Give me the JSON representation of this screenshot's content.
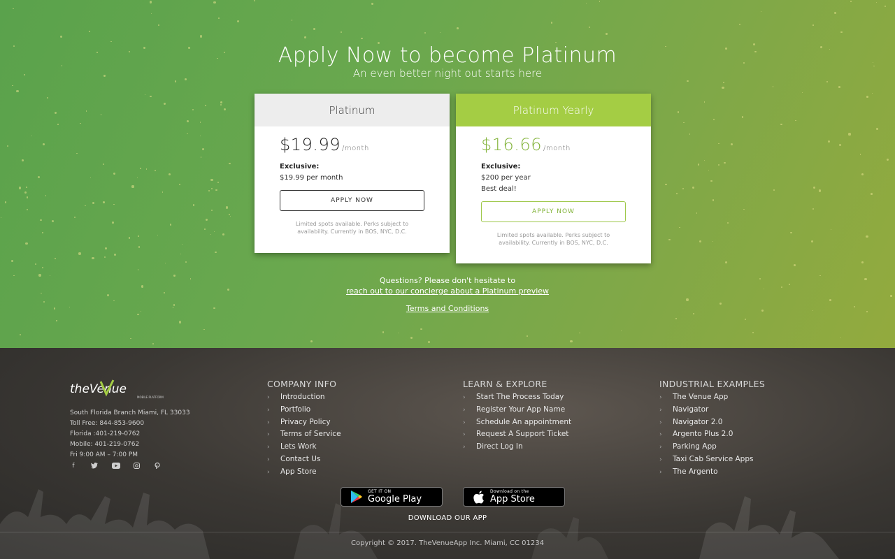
{
  "hero": {
    "title": "Apply Now to become Platinum",
    "subtitle": "An even better night out starts here"
  },
  "plans": [
    {
      "name": "Platinum",
      "price": "$19.99",
      "per": "/month",
      "perk_title": "Exclusive:",
      "perk_lines": [
        "$19.99 per month"
      ],
      "button": "APPLY NOW",
      "fine_print": "Limited spots available. Perks subject to availability. Currently in BOS, NYC, D.C."
    },
    {
      "name": "Platinum Yearly",
      "price": "$16.66",
      "per": "/month",
      "perk_title": "Exclusive:",
      "perk_lines": [
        "$200 per year",
        "Best deal!"
      ],
      "button": "APPLY NOW",
      "fine_print": "Limited spots available. Perks subject to availability. Currently in BOS, NYC, D.C."
    }
  ],
  "questions": {
    "prefix": "Questions? Please don't hesitate to ",
    "link": "reach out to our concierge about a Platinum preview"
  },
  "terms_link": "Terms and Conditions",
  "footer": {
    "logo_text": "theVenue",
    "logo_tagline": "MOBILE PLATFORM",
    "contact": [
      "South Florida Branch Miami, FL 33033",
      "Toll Free: 844-853-9600",
      "Florida :401-219-0762",
      "Mobile: 401-219-0762",
      "Fri 9:00 AM – 7:00 PM"
    ],
    "social_icons": [
      "facebook-icon",
      "twitter-icon",
      "youtube-icon",
      "instagram-icon",
      "pinterest-icon"
    ],
    "columns": [
      {
        "title": "COMPANY INFO",
        "links": [
          "Introduction",
          "Portfolio",
          "Privacy Policy",
          "Terms of Service",
          "Lets Work",
          "Contact Us",
          "App Store"
        ]
      },
      {
        "title": "LEARN & EXPLORE",
        "links": [
          "Start The Process Today",
          "Register Your App Name",
          "Schedule An appointment",
          "Request A Support Ticket",
          "Direct Log In"
        ]
      },
      {
        "title": "INDUSTRIAL EXAMPLES",
        "links": [
          "The Venue App",
          "Navigator",
          "Navigator 2.0",
          "Argento Plus 2.0",
          "Parking App",
          "Taxi Cab Service Apps",
          "The Argento"
        ]
      }
    ],
    "google_play": {
      "small": "GET IT ON",
      "big": "Google Play"
    },
    "app_store": {
      "small": "Download on the",
      "big": "App Store"
    },
    "download_label": "DOWNLOAD OUR APP",
    "copyright": "Copyright © 2017. TheVenueApp Inc. Miami, CC 01234"
  },
  "colors": {
    "hero_green": "#6aa84e",
    "accent_green": "#a4cd44",
    "price_green": "#83b43b",
    "footer_dark": "#2b2a28"
  }
}
